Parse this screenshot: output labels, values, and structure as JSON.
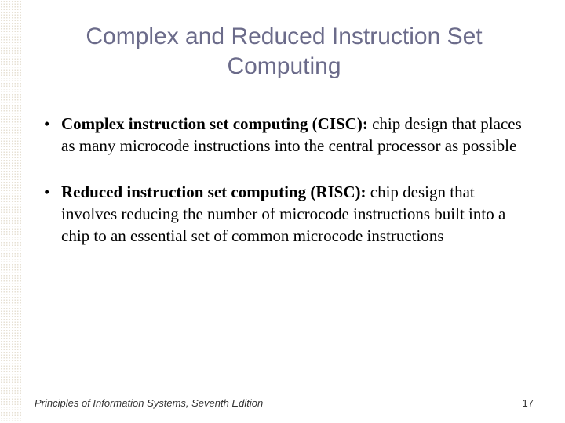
{
  "slide": {
    "title": "Complex and Reduced Instruction Set Computing",
    "bullets": [
      {
        "term": "Complex instruction set computing (CISC):",
        "definition": " chip design that places as many microcode instructions into the central processor as possible"
      },
      {
        "term": "Reduced instruction set computing (RISC):",
        "definition": " chip design that involves reducing the number of microcode instructions built into a chip to an essential set of common microcode instructions"
      }
    ],
    "footer": {
      "source": "Principles of Information Systems, Seventh Edition",
      "page": "17"
    }
  }
}
